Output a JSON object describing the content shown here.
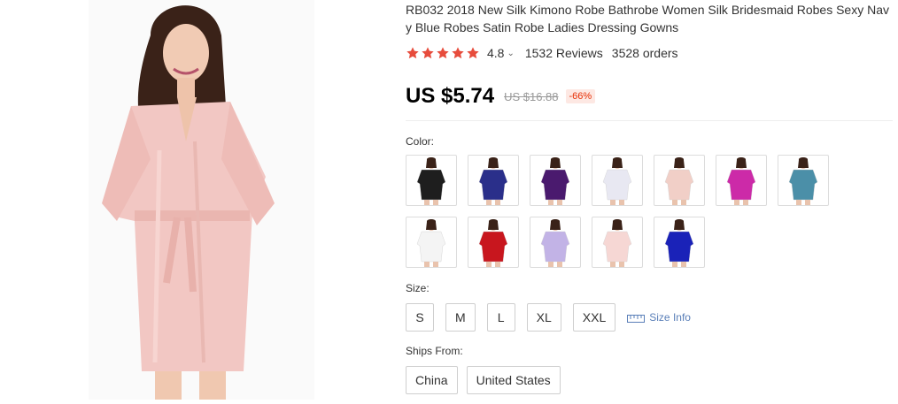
{
  "product": {
    "title": "RB032 2018 New Silk Kimono Robe Bathrobe Women Silk Bridesmaid Robes Sexy Navy Blue Robes Satin Robe Ladies Dressing Gowns",
    "rating": "4.8",
    "rating_stars": 5,
    "reviews": "1532 Reviews",
    "orders": "3528 orders",
    "price": "US $5.74",
    "old_price": "US $16.88",
    "discount": "-66%",
    "main_image_color": "#f2c7c3"
  },
  "colors": {
    "label": "Color:",
    "swatches": [
      {
        "name": "black",
        "hex": "#1e1e1e"
      },
      {
        "name": "navy",
        "hex": "#2a2f8a"
      },
      {
        "name": "purple",
        "hex": "#4a1a6e"
      },
      {
        "name": "white-lilac",
        "hex": "#e8e8f2"
      },
      {
        "name": "light-pink",
        "hex": "#f1cfc7"
      },
      {
        "name": "magenta",
        "hex": "#cc2aa8"
      },
      {
        "name": "teal",
        "hex": "#4b8fa8"
      },
      {
        "name": "white",
        "hex": "#f4f4f4"
      },
      {
        "name": "red",
        "hex": "#c8161e"
      },
      {
        "name": "lavender",
        "hex": "#c2b3e6"
      },
      {
        "name": "blush",
        "hex": "#f6d7d4"
      },
      {
        "name": "royal-blue",
        "hex": "#1a22b8"
      }
    ]
  },
  "size": {
    "label": "Size:",
    "options": [
      "S",
      "M",
      "L",
      "XL",
      "XXL"
    ],
    "info_label": "Size Info"
  },
  "ships": {
    "label": "Ships From:",
    "options": [
      "China",
      "United States"
    ]
  },
  "theme": {
    "star_color": "#e74c3c",
    "discount_color": "#e62e04",
    "link_color": "#5a7fb8"
  }
}
